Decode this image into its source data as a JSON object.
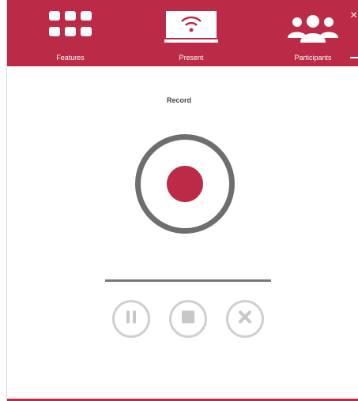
{
  "colors": {
    "brand": "#bb2a46",
    "ring": "#6e6e6e",
    "control_ring": "#cfcfcf",
    "control_glyph": "#c7c7c7",
    "text": "#444444"
  },
  "nav": {
    "items": [
      {
        "label": "Features",
        "icon": "grid-icon"
      },
      {
        "label": "Present",
        "icon": "screen-share-icon"
      },
      {
        "label": "Participants",
        "icon": "people-icon"
      }
    ],
    "close_label": "×"
  },
  "record": {
    "title": "Record"
  },
  "controls": {
    "pause": "pause-icon",
    "stop": "stop-icon",
    "cancel": "cancel-icon"
  }
}
